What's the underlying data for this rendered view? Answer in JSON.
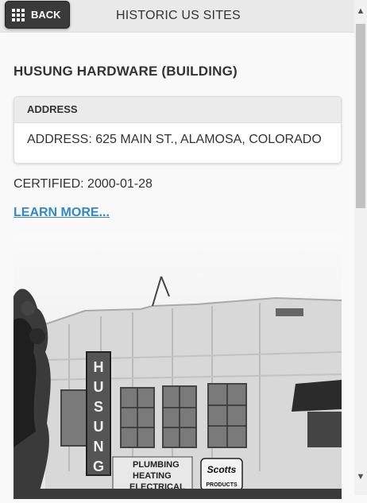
{
  "header": {
    "back_label": "BACK",
    "title": "HISTORIC US SITES"
  },
  "main": {
    "title": "HUSUNG HARDWARE (BUILDING)",
    "address_card": {
      "heading": "ADDRESS",
      "value": "ADDRESS: 625 MAIN ST., ALAMOSA, COLORADO"
    },
    "certified": "CERTIFIED: 2000-01-28",
    "learn_more": "LEARN MORE...",
    "photo": {
      "sign_letters": "HUSUNG",
      "awning_text": "PLUMBING HEATING ELECTRICAL",
      "scotts_sign": "Scotts",
      "scotts_sub": "LAWN PRODUCTS"
    }
  },
  "colors": {
    "link": "#3388cc",
    "header_bg": "#e9e9e9",
    "back_button_bg": "#3a3a3a"
  },
  "icons": [
    "grid-icon",
    "chevron-up-icon",
    "chevron-down-icon"
  ]
}
